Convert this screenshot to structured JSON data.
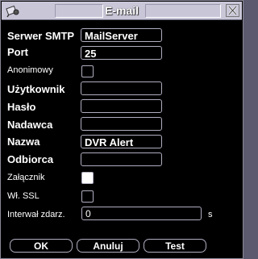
{
  "dialog": {
    "title": "E-mail"
  },
  "form": {
    "smtp_server": {
      "label": "Serwer SMTP",
      "value": "MailServer"
    },
    "port": {
      "label": "Port",
      "value": "25"
    },
    "anonymous": {
      "label": "Anonimowy",
      "checked": false
    },
    "user": {
      "label": "Użytkownik",
      "value": ""
    },
    "password": {
      "label": "Hasło",
      "value": ""
    },
    "sender": {
      "label": "Nadawca",
      "value": ""
    },
    "subject": {
      "label": "Nazwa",
      "value": "DVR Alert"
    },
    "recipient": {
      "label": "Odbiorca",
      "value": ""
    },
    "attachment": {
      "label": "Załącznik",
      "checked": true
    },
    "ssl": {
      "label": "Wł. SSL",
      "checked": false
    },
    "interval": {
      "label": "Interwał zdarz.",
      "value": "0",
      "unit": "s"
    }
  },
  "buttons": {
    "ok": "OK",
    "cancel": "Anuluj",
    "test": "Test"
  },
  "icons": {
    "app": "camera-icon",
    "close": "close-icon"
  }
}
